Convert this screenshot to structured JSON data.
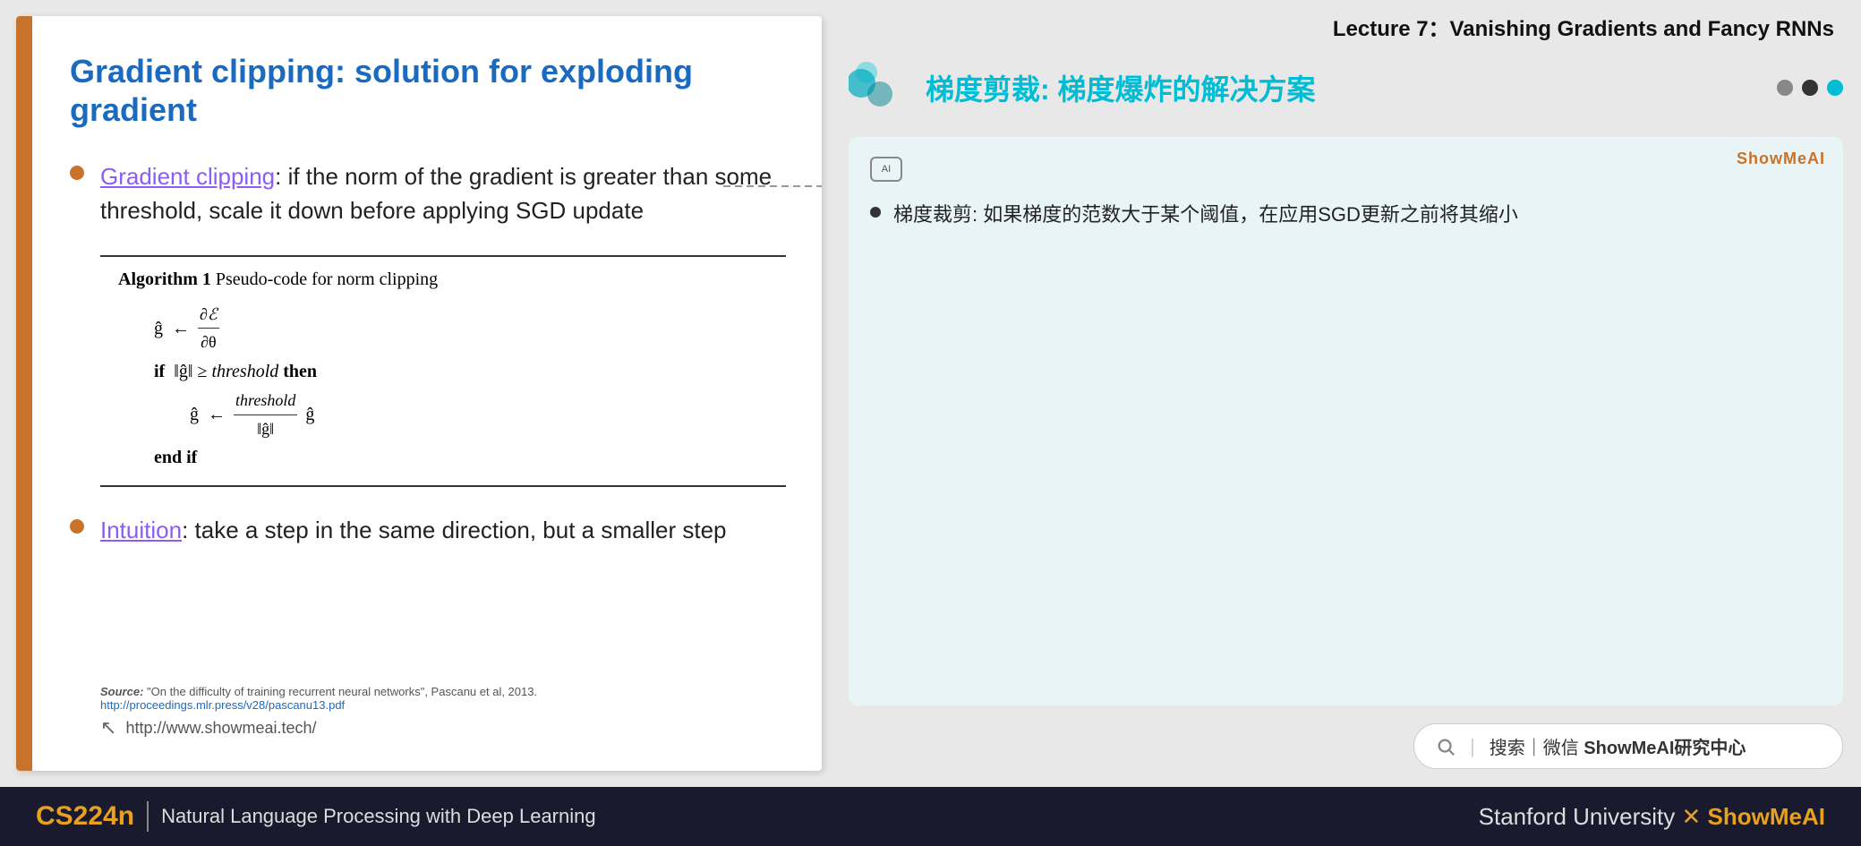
{
  "slide": {
    "title": "Gradient clipping: solution for exploding gradient",
    "bullet1_link": "Gradient clipping",
    "bullet1_text": ": if the norm of the gradient is greater than some threshold, scale it down before applying SGD update",
    "algorithm_title_bold": "Algorithm 1",
    "algorithm_title_normal": " Pseudo-code for norm clipping",
    "algo_lines": [
      "ĝ ← ∂ℰ/∂θ",
      "if  ‖ĝ‖ ≥ threshold then",
      "ĝ ← (threshold/‖ĝ‖) ĝ",
      "end if"
    ],
    "bullet2_link": "Intuition",
    "bullet2_text": ": take a step in the same direction, but a smaller step",
    "source_label": "Source:",
    "source_text": " \"On the difficulty of training recurrent neural networks\", Pascanu et al, 2013. ",
    "source_url": "http://proceedings.mlr.press/v28/pascanu13.pdf",
    "footer_url": "http://www.showmeai.tech/"
  },
  "right": {
    "lecture_title": "Lecture 7：Vanishing Gradients and Fancy RNNs",
    "topic_title_cn": "梯度剪裁: 梯度爆炸的解决方案",
    "nav_dots": [
      "gray",
      "dark",
      "cyan"
    ],
    "ai_icon_text": "AI",
    "showmeai_badge": "ShowMeAI",
    "translation_bullet": "梯度裁剪: 如果梯度的范数大于某个阈值，在应用SGD更新之前将其缩小",
    "search_text": "搜索｜微信 ",
    "search_brand": "ShowMeAI研究中心"
  },
  "bottom": {
    "course_code": "CS224n",
    "divider": "|",
    "course_name": "Natural Language Processing with Deep Learning",
    "university": "Stanford University",
    "brand_x": "✕",
    "brand_showmeai": "ShowMeAI"
  }
}
